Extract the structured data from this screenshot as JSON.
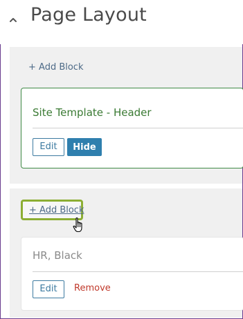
{
  "header": {
    "title": "Page Layout",
    "toggle_icon": "chevron-up-icon"
  },
  "sections": [
    {
      "add_block_label": "+ Add Block",
      "block": {
        "title": "Site Template - Header",
        "edit_label": "Edit",
        "hide_label": "Hide",
        "state": "selected"
      }
    },
    {
      "add_block_label": "+ Add Block",
      "add_block_highlighted": true,
      "block": {
        "title": "HR, Black",
        "edit_label": "Edit",
        "remove_label": "Remove"
      }
    }
  ],
  "cursor": {
    "icon": "hand-pointer-icon"
  },
  "colors": {
    "frame": "#6a3d8f",
    "highlight": "#8cae33",
    "selected_border": "#3f8a45",
    "primary": "#2f7fae",
    "danger": "#c0392b",
    "link": "#4d6a87"
  }
}
